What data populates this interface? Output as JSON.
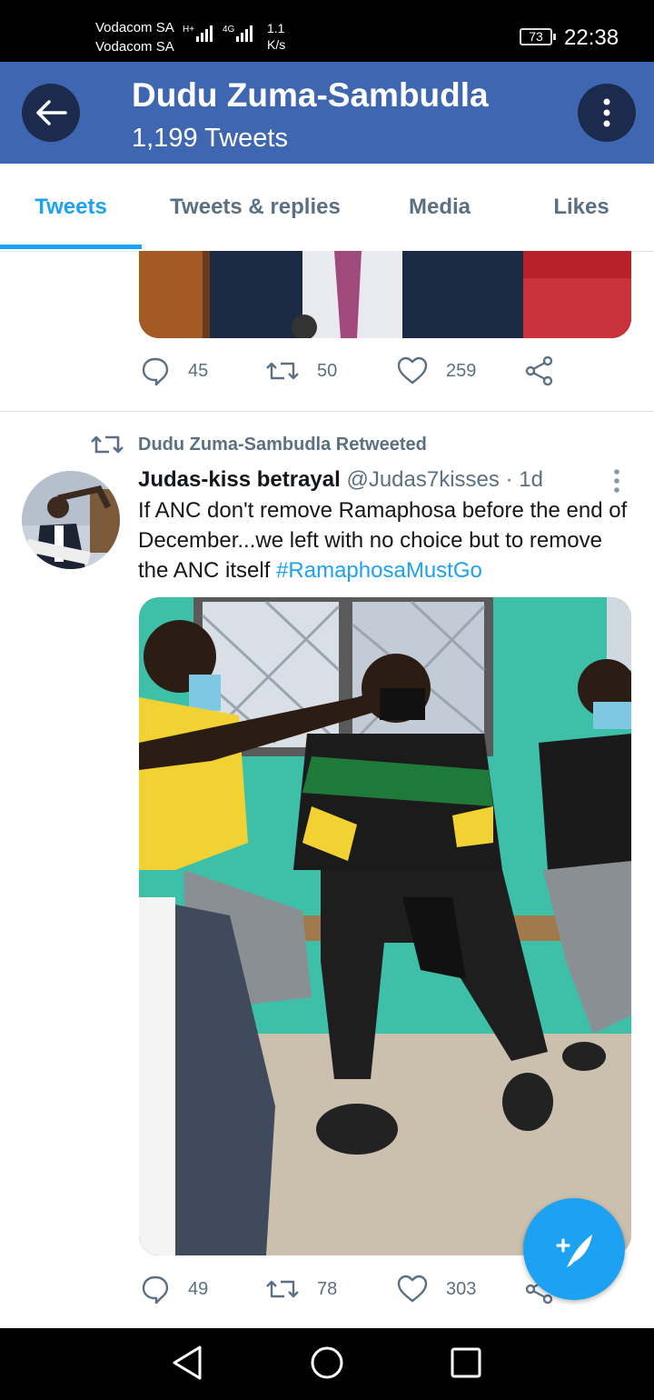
{
  "status_bar": {
    "carrier_1": "Vodacom SA",
    "carrier_2": "Vodacom SA",
    "network_1": "H+",
    "network_2": "4G",
    "speed_value": "1.1",
    "speed_unit": "K/s",
    "battery": "73",
    "time": "22:38"
  },
  "header": {
    "name": "Dudu Zuma-Sambudla",
    "subtitle": "1,199 Tweets",
    "back_icon": "arrow-left-icon",
    "more_icon": "more-vertical-icon"
  },
  "tabs": [
    {
      "label": "Tweets",
      "active": true
    },
    {
      "label": "Tweets & replies",
      "active": false
    },
    {
      "label": "Media",
      "active": false
    },
    {
      "label": "Likes",
      "active": false
    }
  ],
  "tweet_1": {
    "replies": "45",
    "retweets": "50",
    "likes": "259"
  },
  "tweet_2": {
    "retweeted_by": "Dudu Zuma-Sambudla Retweeted",
    "name": "Judas-kiss betrayal",
    "handle": "@Judas7kisses",
    "separator": "·",
    "time": "1d",
    "text": "If ANC don't remove Ramaphosa before the end of December...we left with no choice but to remove the ANC itself ",
    "hashtag": "#RamaphosaMustGo",
    "replies": "49",
    "retweets": "78",
    "likes": "303"
  },
  "accent_color": "#1da1f2",
  "header_color": "#3f67b1"
}
